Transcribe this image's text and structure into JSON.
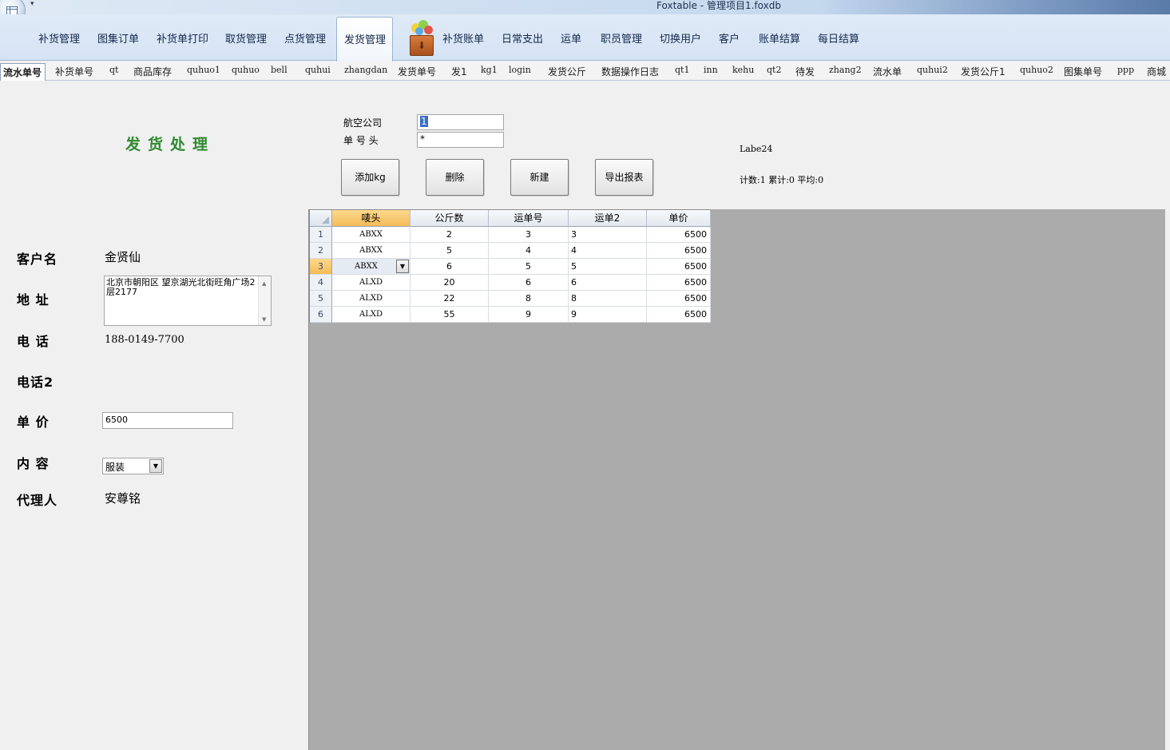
{
  "window": {
    "title": "Foxtable - 管理项目1.foxdb",
    "qat_glyph": "▾"
  },
  "ribbon": {
    "tabs": [
      "补货管理",
      "图集订单",
      "补货单打印",
      "取货管理",
      "点货管理",
      "发货管理",
      "补货账单",
      "日常支出",
      "运单",
      "职员管理",
      "切换用户",
      "客户",
      "账单结算",
      "每日结算"
    ],
    "active_tab": "发货管理"
  },
  "sheet_tabs": {
    "items": [
      "流水单号",
      "补货单号",
      "qt",
      "商品库存",
      "quhuo1",
      "quhuo",
      "bell",
      "quhui",
      "zhangdan",
      "发货单号",
      "发1",
      "kg1",
      "login",
      "发货公斤",
      "数据操作日志",
      "qt1",
      "inn",
      "kehu",
      "qt2",
      "待发",
      "zhang2",
      "流水单",
      "quhui2",
      "发货公斤1",
      "quhuo2",
      "图集单号",
      "ppp",
      "商城"
    ],
    "active": "流水单号"
  },
  "form": {
    "heading": "发货处理",
    "customer_label": "客户名",
    "customer_value": "金贤仙",
    "address_label": "地 址",
    "address_value": "北京市朝阳区 望京湖光北街旺角广场2层2177",
    "phone_label": "电 话",
    "phone_value": "188-0149-7700",
    "phone2_label": "电话2",
    "price_label": "单 价",
    "price_value": "6500",
    "content_label": "内 容",
    "content_value": "服装",
    "agent_label": "代理人",
    "agent_value": "安尊铭"
  },
  "filter": {
    "airline_label": "航空公司",
    "airline_value": "1",
    "prefix_label": "单 号 头",
    "prefix_value": "*"
  },
  "buttons": {
    "add_kg": "添加kg",
    "delete": "删除",
    "new": "新建",
    "export": "导出报表"
  },
  "info": {
    "label24": "Labe24",
    "stats": "计数:1 累计:0 平均:0"
  },
  "grid": {
    "columns": [
      "唛头",
      "公斤数",
      "运单号",
      "运单2",
      "单价"
    ],
    "selected_row": 3,
    "rows": [
      {
        "n": "1",
        "mark": "ABXX",
        "kg": "2",
        "waybill": "3",
        "waybill2": "3",
        "price": "6500"
      },
      {
        "n": "2",
        "mark": "ABXX",
        "kg": "5",
        "waybill": "4",
        "waybill2": "4",
        "price": "6500"
      },
      {
        "n": "3",
        "mark": "ABXX",
        "kg": "6",
        "waybill": "5",
        "waybill2": "5",
        "price": "6500"
      },
      {
        "n": "4",
        "mark": "ALXD",
        "kg": "20",
        "waybill": "6",
        "waybill2": "6",
        "price": "6500"
      },
      {
        "n": "5",
        "mark": "ALXD",
        "kg": "22",
        "waybill": "8",
        "waybill2": "8",
        "price": "6500"
      },
      {
        "n": "6",
        "mark": "ALXD",
        "kg": "55",
        "waybill": "9",
        "waybill2": "9",
        "price": "6500"
      }
    ]
  }
}
